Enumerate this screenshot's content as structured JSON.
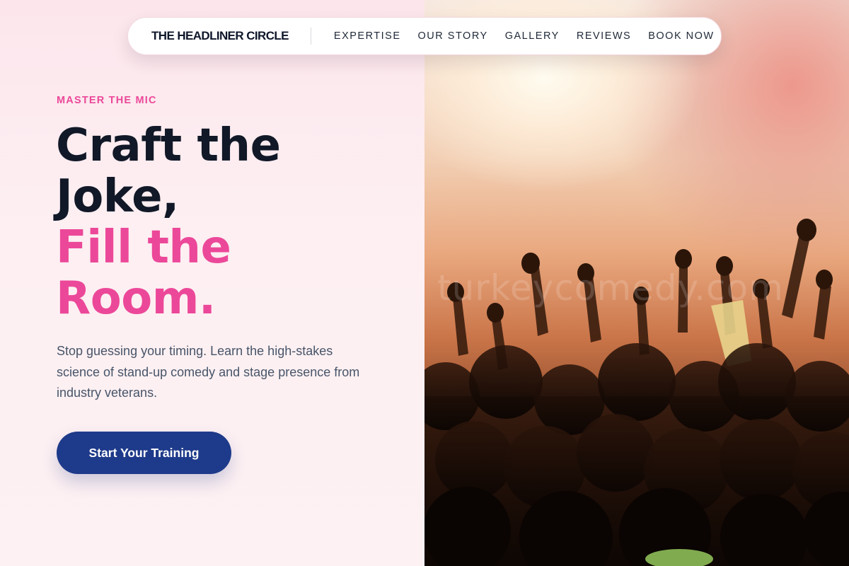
{
  "nav": {
    "brand": "THE HEADLINER CIRCLE",
    "links": [
      "EXPERTISE",
      "OUR STORY",
      "GALLERY",
      "REVIEWS",
      "BOOK NOW"
    ]
  },
  "hero": {
    "eyebrow": "MASTER THE MIC",
    "headline_line1": "Craft the",
    "headline_line2": "Joke,",
    "headline_line3": "Fill the",
    "headline_line4": "Room.",
    "description": "Stop guessing your timing. Learn the high-stakes science of stand-up comedy and stage presence from industry veterans.",
    "cta_label": "Start Your Training"
  },
  "image": {
    "watermark": "turkeycomedy.com"
  },
  "colors": {
    "accent_pink": "#ec4899",
    "primary_navy": "#1e3a8a",
    "heading_dark": "#111827",
    "body_text": "#475569",
    "background": "#fdf0f3"
  }
}
